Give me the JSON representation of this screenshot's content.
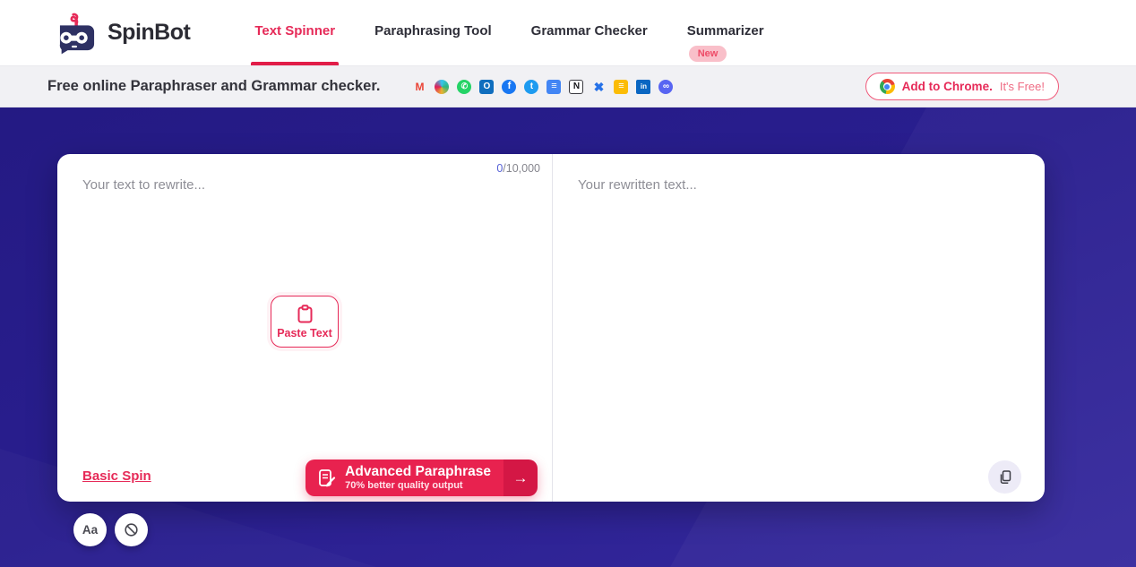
{
  "brand": {
    "name": "SpinBot"
  },
  "nav": {
    "items": [
      {
        "label": "Text Spinner",
        "active": true
      },
      {
        "label": "Paraphrasing Tool"
      },
      {
        "label": "Grammar Checker"
      },
      {
        "label": "Summarizer",
        "badge": "New"
      }
    ]
  },
  "subheader": {
    "tagline": "Free online Paraphraser and Grammar checker.",
    "apps": [
      {
        "name": "gmail-icon",
        "glyph": "M",
        "fg": "#ea4335",
        "bg": "transparent",
        "radius": "2px",
        "font": "12px"
      },
      {
        "name": "slack-icon",
        "glyph": "",
        "fg": "#fff",
        "bg": "conic-gradient(#36c5f0,#2eb67d,#ecb22e,#e01e5a,#36c5f0)",
        "radius": "50%",
        "font": "9px"
      },
      {
        "name": "whatsapp-icon",
        "glyph": "✆",
        "fg": "#ffffff",
        "bg": "#25d366",
        "radius": "50%",
        "font": "9px"
      },
      {
        "name": "outlook-icon",
        "glyph": "O",
        "fg": "#ffffff",
        "bg": "#106ebe",
        "radius": "3px",
        "font": "10px"
      },
      {
        "name": "facebook-icon",
        "glyph": "f",
        "fg": "#ffffff",
        "bg": "#1877f2",
        "radius": "50%",
        "font": "11px"
      },
      {
        "name": "twitter-icon",
        "glyph": "t",
        "fg": "#ffffff",
        "bg": "#1d9bf0",
        "radius": "50%",
        "font": "10px"
      },
      {
        "name": "google-docs-icon",
        "glyph": "≡",
        "fg": "#ffffff",
        "bg": "#4285f4",
        "radius": "3px",
        "font": "11px"
      },
      {
        "name": "notion-icon",
        "glyph": "N",
        "fg": "#16161a",
        "bg": "#ffffff",
        "radius": "3px",
        "font": "10px",
        "border": "1px solid #3a3a40"
      },
      {
        "name": "x-app-icon",
        "glyph": "✖",
        "fg": "#2672e8",
        "bg": "transparent",
        "radius": "2px",
        "font": "14px"
      },
      {
        "name": "google-slides-icon",
        "glyph": "≡",
        "fg": "#ffffff",
        "bg": "#fbbc05",
        "radius": "3px",
        "font": "11px"
      },
      {
        "name": "linkedin-icon",
        "glyph": "in",
        "fg": "#ffffff",
        "bg": "#0a66c2",
        "radius": "2px",
        "font": "8px"
      },
      {
        "name": "discord-icon",
        "glyph": "∞",
        "fg": "#ffffff",
        "bg": "#5865f2",
        "radius": "50%",
        "font": "10px"
      }
    ],
    "chrome_button": {
      "primary": "Add to Chrome.",
      "secondary": "It's Free!"
    }
  },
  "editor": {
    "counter": {
      "current": "0",
      "limit": "/10,000"
    },
    "input_placeholder": "Your text to rewrite...",
    "output_placeholder": "Your rewritten text...",
    "paste_button": "Paste Text",
    "basic_spin": "Basic Spin",
    "advanced": {
      "title": "Advanced Paraphrase",
      "subtitle": "70% better quality output",
      "arrow": "→"
    }
  },
  "controls": {
    "case_label": "Aa"
  },
  "colors": {
    "accent": "#e62a58",
    "accent_dark": "#d41745",
    "indigo_top": "#241a83",
    "indigo_bottom": "#362a9e",
    "promo_bg": "#f1f1f4",
    "badge_bg": "#f9bfc9",
    "placeholder": "#8e8e96",
    "counter_blue": "#5661d6"
  }
}
